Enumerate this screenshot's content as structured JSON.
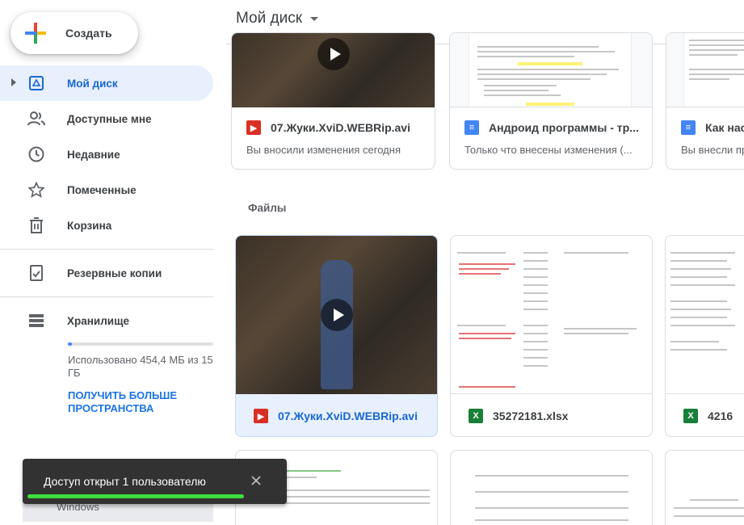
{
  "sidebar": {
    "create_label": "Создать",
    "items": [
      {
        "label": "Мой диск",
        "icon": "drive-icon",
        "active": true
      },
      {
        "label": "Доступные мне",
        "icon": "people-icon"
      },
      {
        "label": "Недавние",
        "icon": "clock-icon"
      },
      {
        "label": "Помеченные",
        "icon": "star-icon"
      },
      {
        "label": "Корзина",
        "icon": "trash-icon"
      },
      {
        "label": "Резервные копии",
        "icon": "backup-icon"
      },
      {
        "label": "Хранилище",
        "icon": "storage-icon"
      }
    ],
    "storage": {
      "used_text": "Использовано 454,4 МБ из 15 ГБ",
      "used_fraction": 0.03,
      "upgrade_label": "ПОЛУЧИТЬ БОЛЬШЕ ПРОСТРАНСТВА"
    },
    "hidden_item": "Windows"
  },
  "header": {
    "title": "Мой диск"
  },
  "quick_access": [
    {
      "name": "07.Жуки.XviD.WEBRip.avi",
      "sub": "Вы вносили изменения сегодня",
      "type": "video"
    },
    {
      "name": "Андроид программы - тр...",
      "sub": "Только что внесены изменения (...",
      "type": "doc"
    },
    {
      "name": "Как нас",
      "sub": "Вы внесли пр",
      "type": "doc"
    }
  ],
  "files_section_label": "Файлы",
  "files": [
    {
      "name": "07.Жуки.XviD.WEBRip.avi",
      "type": "video",
      "selected": true
    },
    {
      "name": "35272181.xlsx",
      "type": "xls"
    },
    {
      "name": "4216",
      "type": "xls"
    }
  ],
  "toast": {
    "message": "Доступ открыт 1 пользователю",
    "close_label": "✕"
  },
  "colors": {
    "accent": "#1a73e8",
    "active_bg": "#e8f0fe",
    "toast_bg": "#323232",
    "highlight": "#3ddc3d"
  }
}
